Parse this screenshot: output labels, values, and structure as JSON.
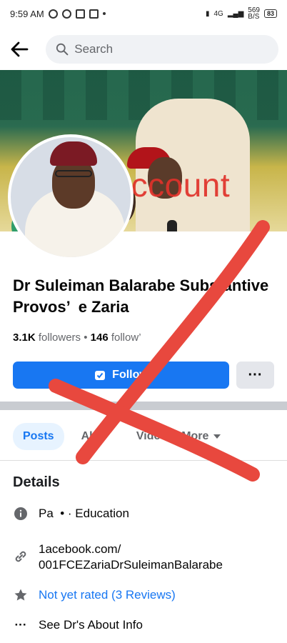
{
  "status_bar": {
    "time": "9:59 AM",
    "network": "4G",
    "speed": "569\nB/S",
    "battery": "83"
  },
  "search": {
    "placeholder": "Search"
  },
  "cover": {
    "watermark": "Fake account"
  },
  "profile": {
    "name": "Dr Suleiman Balarabe Substantive Provos’  e Zaria",
    "followers_count": "3.1K",
    "followers_label": "followers",
    "following_count": "146",
    "following_label": "follow’",
    "follow_label": "Follow",
    "more_label": "···"
  },
  "tabs": {
    "posts": "Posts",
    "about": "Ab",
    "videos": "Video",
    "more": "More"
  },
  "details": {
    "heading": "Details",
    "category": "Pa  • · Education",
    "link_line1": "1acebook.com/",
    "link_line2": "001FCEZariaDrSuleimanBalarabe",
    "rating": "Not yet rated (3 Reviews)",
    "about": "See Dr's About Info"
  },
  "colors": {
    "accent": "#1877f2",
    "watermark": "#e0322a"
  }
}
